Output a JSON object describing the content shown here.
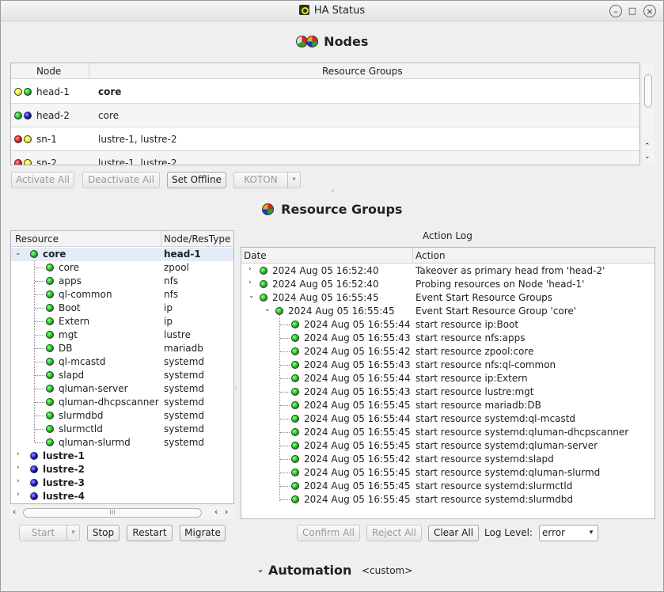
{
  "window": {
    "title": "HA Status"
  },
  "nodes_section": {
    "title": "Nodes"
  },
  "nodes_table": {
    "headers": {
      "node": "Node",
      "resource_groups": "Resource Groups"
    },
    "rows": [
      {
        "node": "head-1",
        "groups": "core",
        "dots": [
          "y",
          "g"
        ],
        "bold": true
      },
      {
        "node": "head-2",
        "groups": "core",
        "dots": [
          "g",
          "b"
        ],
        "bold": false
      },
      {
        "node": "sn-1",
        "groups": "lustre-1, lustre-2",
        "dots": [
          "r",
          "y"
        ],
        "bold": false
      },
      {
        "node": "sn-2",
        "groups": "lustre-1, lustre-2",
        "dots": [
          "r",
          "y"
        ],
        "bold": false
      }
    ]
  },
  "nodes_buttons": {
    "activate_all": "Activate All",
    "deactivate_all": "Deactivate All",
    "set_offline": "Set Offline",
    "koton": "KOTON"
  },
  "rg_section": {
    "title": "Resource Groups"
  },
  "rg_tree": {
    "headers": {
      "resource": "Resource",
      "node_restype": "Node/ResType"
    },
    "core": {
      "name": "core",
      "node": "head-1"
    },
    "children": [
      {
        "name": "core",
        "type": "zpool"
      },
      {
        "name": "apps",
        "type": "nfs"
      },
      {
        "name": "ql-common",
        "type": "nfs"
      },
      {
        "name": "Boot",
        "type": "ip"
      },
      {
        "name": "Extern",
        "type": "ip"
      },
      {
        "name": "mgt",
        "type": "lustre"
      },
      {
        "name": "DB",
        "type": "mariadb"
      },
      {
        "name": "ql-mcastd",
        "type": "systemd"
      },
      {
        "name": "slapd",
        "type": "systemd"
      },
      {
        "name": "qluman-server",
        "type": "systemd"
      },
      {
        "name": "qluman-dhcpscanner",
        "type": "systemd"
      },
      {
        "name": "slurmdbd",
        "type": "systemd"
      },
      {
        "name": "slurmctld",
        "type": "systemd"
      },
      {
        "name": "qluman-slurmd",
        "type": "systemd"
      }
    ],
    "collapsed": [
      "lustre-1",
      "lustre-2",
      "lustre-3",
      "lustre-4"
    ],
    "scroll_handle": "III"
  },
  "rg_buttons": {
    "start": "Start",
    "stop": "Stop",
    "restart": "Restart",
    "migrate": "Migrate"
  },
  "action_log": {
    "title": "Action Log",
    "headers": {
      "date": "Date",
      "action": "Action"
    },
    "top": [
      {
        "date": "2024 Aug 05 16:52:40",
        "action": "Takeover as primary head from 'head-2'"
      },
      {
        "date": "2024 Aug 05 16:52:40",
        "action": "Probing resources on Node 'head-1'"
      },
      {
        "date": "2024 Aug 05 16:55:45",
        "action": "Event Start Resource Groups"
      }
    ],
    "group": {
      "date": "2024 Aug 05 16:55:45",
      "action": "Event Start Resource Group 'core'"
    },
    "entries": [
      {
        "date": "2024 Aug 05 16:55:44",
        "action": "start resource ip:Boot"
      },
      {
        "date": "2024 Aug 05 16:55:43",
        "action": "start resource nfs:apps"
      },
      {
        "date": "2024 Aug 05 16:55:42",
        "action": "start resource zpool:core"
      },
      {
        "date": "2024 Aug 05 16:55:43",
        "action": "start resource nfs:ql-common"
      },
      {
        "date": "2024 Aug 05 16:55:44",
        "action": "start resource ip:Extern"
      },
      {
        "date": "2024 Aug 05 16:55:43",
        "action": "start resource lustre:mgt"
      },
      {
        "date": "2024 Aug 05 16:55:45",
        "action": "start resource mariadb:DB"
      },
      {
        "date": "2024 Aug 05 16:55:44",
        "action": "start resource systemd:ql-mcastd"
      },
      {
        "date": "2024 Aug 05 16:55:45",
        "action": "start resource systemd:qluman-dhcpscanner"
      },
      {
        "date": "2024 Aug 05 16:55:45",
        "action": "start resource systemd:qluman-server"
      },
      {
        "date": "2024 Aug 05 16:55:42",
        "action": "start resource systemd:slapd"
      },
      {
        "date": "2024 Aug 05 16:55:45",
        "action": "start resource systemd:qluman-slurmd"
      },
      {
        "date": "2024 Aug 05 16:55:45",
        "action": "start resource systemd:slurmctld"
      },
      {
        "date": "2024 Aug 05 16:55:45",
        "action": "start resource systemd:slurmdbd"
      }
    ]
  },
  "log_buttons": {
    "confirm_all": "Confirm All",
    "reject_all": "Reject All",
    "clear_all": "Clear All",
    "log_level_label": "Log Level:",
    "log_level_value": "error"
  },
  "automation": {
    "title": "Automation",
    "value": "<custom>"
  }
}
